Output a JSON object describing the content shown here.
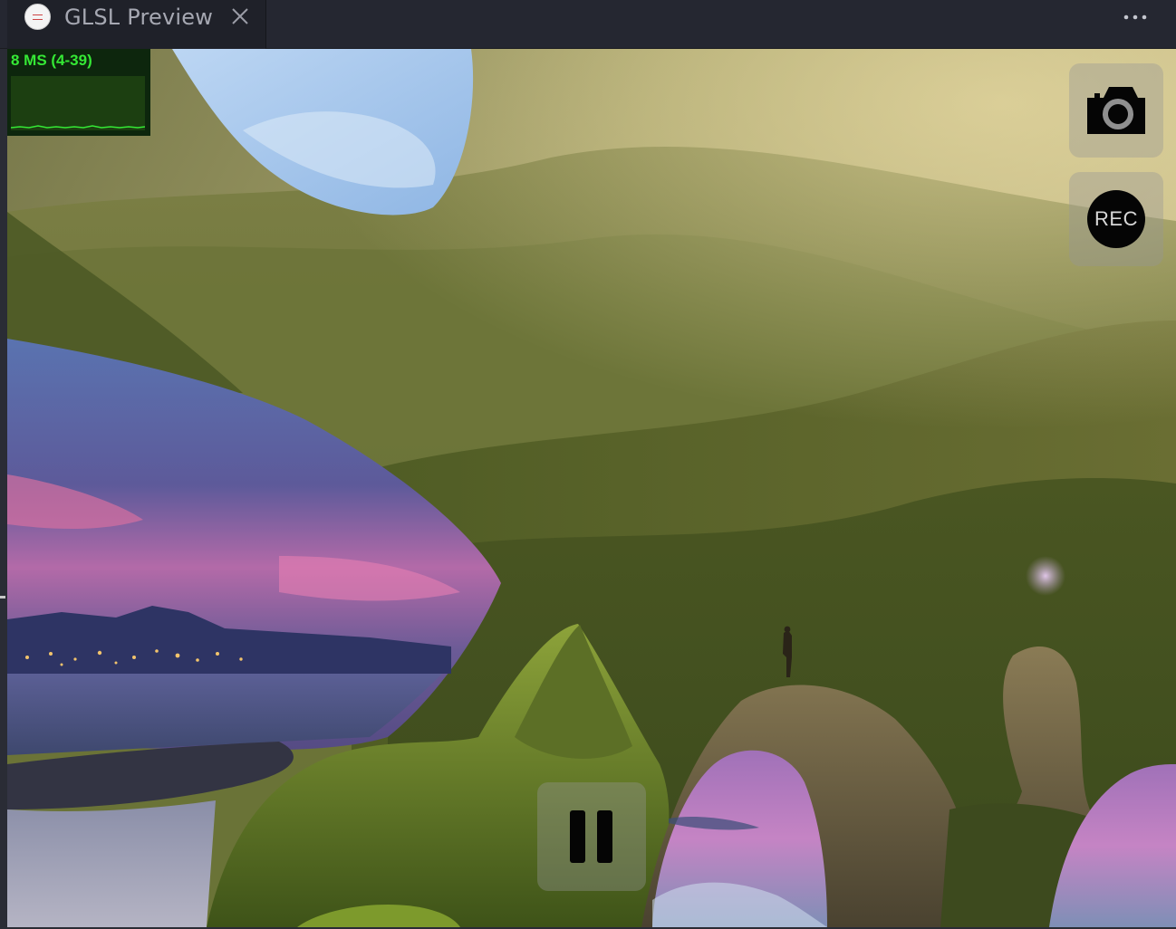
{
  "tab": {
    "title": "GLSL Preview",
    "icon": "glsl-preview-logo-icon"
  },
  "toolbar": {
    "more_icon": "more-actions-icon"
  },
  "stats": {
    "frame_time": "8 MS (4-39)",
    "graph_color": "#35e835"
  },
  "controls": {
    "camera_icon": "camera-icon",
    "record_label": "REC",
    "pause_icon": "pause-icon"
  },
  "colors": {
    "tabbar_bg": "#252731",
    "stats_text": "#35e835",
    "button_overlay": "rgba(150,150,150,0.38)"
  }
}
